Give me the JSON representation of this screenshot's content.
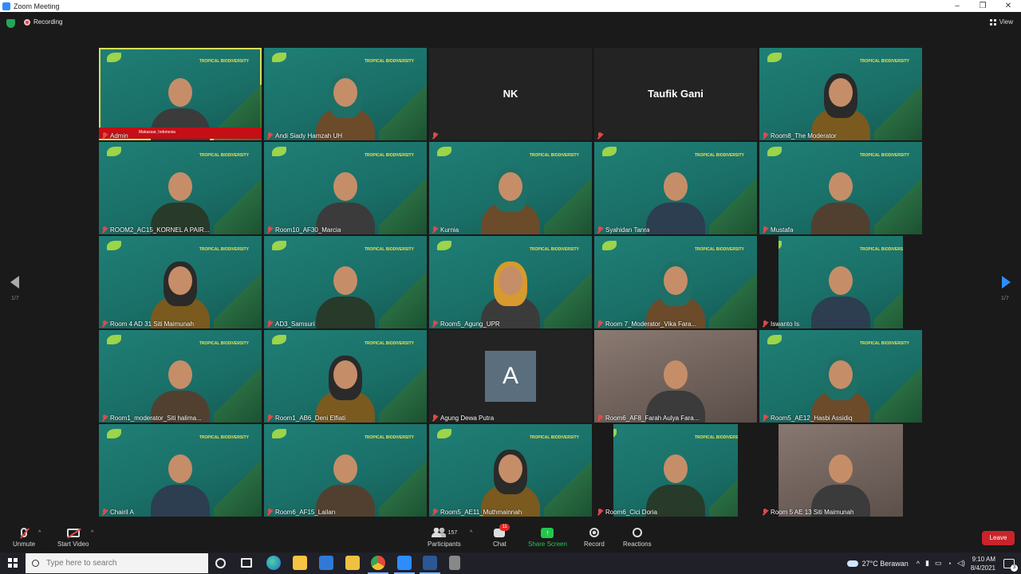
{
  "window": {
    "title": "Zoom Meeting",
    "minimize": "–",
    "restore": "❐",
    "close": "✕"
  },
  "topbar": {
    "recording_label": "Recording",
    "view_label": "View"
  },
  "gallery": {
    "page_left": "1/7",
    "page_right": "1/7",
    "banner_text": "TROPICAL BIODIVERSITY",
    "tiles": [
      {
        "name": "Admin",
        "kind": "video",
        "active": true,
        "location": "Makassar, Indonesia"
      },
      {
        "name": "Andi Siady Hamzah UH",
        "kind": "video"
      },
      {
        "name": "",
        "kind": "blank",
        "label": "NK"
      },
      {
        "name": "",
        "kind": "blank",
        "label": "Taufik Gani"
      },
      {
        "name": "Room8_The Moderator",
        "kind": "video"
      },
      {
        "name": "ROOM2_AC15_KORNEL A PAIR...",
        "kind": "video"
      },
      {
        "name": "Room10_AF30_Marcia",
        "kind": "video"
      },
      {
        "name": "Kurnia",
        "kind": "video"
      },
      {
        "name": "Syahidan Tanra",
        "kind": "video"
      },
      {
        "name": "Mustafa",
        "kind": "video"
      },
      {
        "name": "Room 4 AD 31 Siti Maimunah",
        "kind": "video"
      },
      {
        "name": "AD3_Samsuri",
        "kind": "video"
      },
      {
        "name": "Room5_Agung_UPR",
        "kind": "video"
      },
      {
        "name": "Room 7_Moderator_Vika Fara...",
        "kind": "video"
      },
      {
        "name": "Iswanto Is",
        "kind": "video-narrow"
      },
      {
        "name": "Room1_moderator_Siti halima...",
        "kind": "video"
      },
      {
        "name": "Room1_AB6_Deni Elfiati",
        "kind": "video"
      },
      {
        "name": "Agung Dewa Putra",
        "kind": "avatar",
        "initial": "A"
      },
      {
        "name": "Room6_AF8_Farah Aulya Fara...",
        "kind": "video-room"
      },
      {
        "name": "Room5_AE12_Hasbi Assidiq",
        "kind": "video"
      },
      {
        "name": "Chairil A",
        "kind": "video"
      },
      {
        "name": "Room6_AF15_Lailan",
        "kind": "video"
      },
      {
        "name": "Room5_AE11_Muthmainnah",
        "kind": "video"
      },
      {
        "name": "Room6_Cici Doria",
        "kind": "video-narrow"
      },
      {
        "name": "Room 5 AE 13 Siti Maimunah",
        "kind": "video-room-narrow"
      }
    ]
  },
  "toolbar": {
    "unmute": "Unmute",
    "start_video": "Start Video",
    "participants": "Participants",
    "participants_count": "157",
    "chat": "Chat",
    "chat_badge": "11",
    "share_screen": "Share Screen",
    "record": "Record",
    "reactions": "Reactions",
    "leave": "Leave"
  },
  "taskbar": {
    "search_placeholder": "Type here to search",
    "weather": "27°C Berawan",
    "time": "9:10 AM",
    "date": "8/4/2021",
    "notifications": "3"
  }
}
